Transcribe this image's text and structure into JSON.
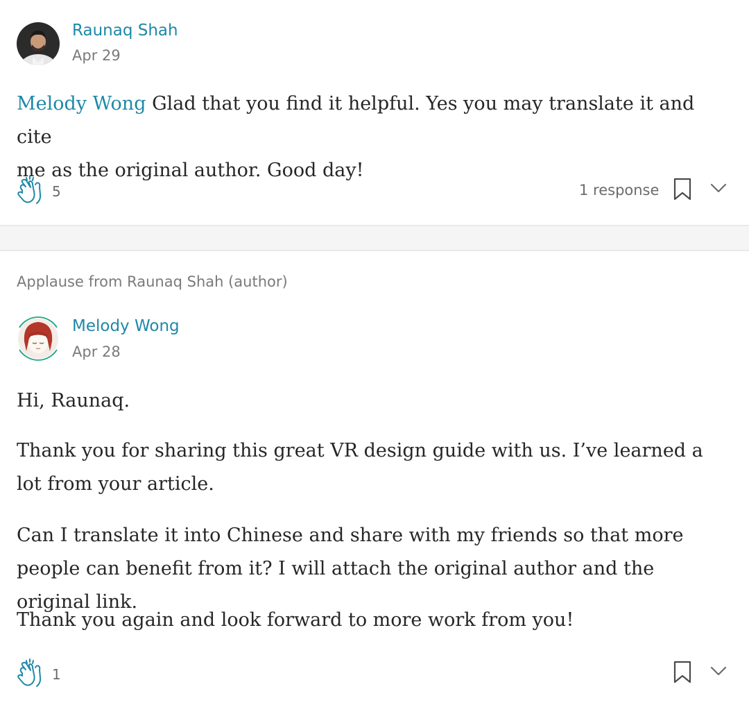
{
  "response_1": {
    "author": "Raunaq Shah",
    "date": "Apr 29",
    "mention": "Melody Wong",
    "text_line_1": " Glad that you find it helpful. Yes you may translate it and cite",
    "text_line_2": "me as the original author. Good day!",
    "claps": "5",
    "responses_label": "1 response",
    "icons": [
      "avatar",
      "clap-icon",
      "bookmark-icon",
      "chevron-down-icon"
    ]
  },
  "applause_note": "Applause from Raunaq Shah (author)",
  "response_2": {
    "author": "Melody Wong",
    "date": "Apr 28",
    "paragraphs": [
      "Hi, Raunaq.",
      "Thank you for sharing this great VR design guide with us. I’ve learned a lot from your article.",
      "Can I translate it into Chinese and share with my friends so that more people can benefit from it? I will attach the original author and the original link.",
      "Thank you again and look forward to more work from you!"
    ],
    "claps": "1",
    "icons": [
      "avatar",
      "clap-icon",
      "bookmark-icon",
      "chevron-down-icon"
    ]
  },
  "colors": {
    "link": "#1e88a8",
    "meta": "#7a7a7a",
    "text": "#262626",
    "divider": "#f5f5f5"
  }
}
